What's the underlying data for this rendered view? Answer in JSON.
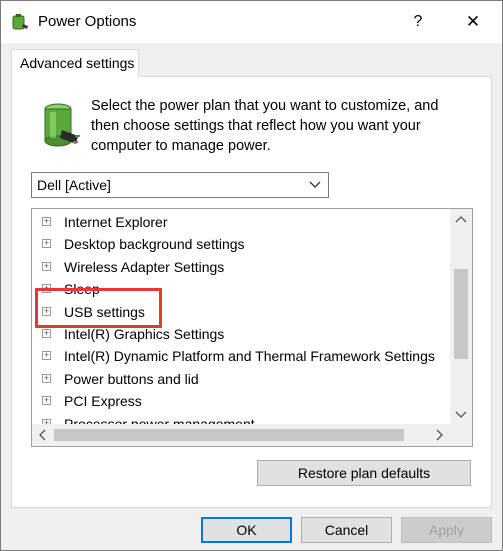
{
  "window": {
    "title": "Power Options",
    "help_glyph": "?",
    "close_glyph": "✕"
  },
  "tab": {
    "label": "Advanced settings"
  },
  "description": "Select the power plan that you want to customize, and then choose settings that reflect how you want your computer to manage power.",
  "plan_select": {
    "value": "Dell [Active]"
  },
  "settings_tree": {
    "items": [
      {
        "label": "Internet Explorer"
      },
      {
        "label": "Desktop background settings"
      },
      {
        "label": "Wireless Adapter Settings"
      },
      {
        "label": "Sleep"
      },
      {
        "label": "USB settings"
      },
      {
        "label": "Intel(R) Graphics Settings"
      },
      {
        "label": "Intel(R) Dynamic Platform and Thermal Framework Settings"
      },
      {
        "label": "Power buttons and lid"
      },
      {
        "label": "PCI Express"
      },
      {
        "label": "Processor power management"
      }
    ],
    "expander_glyph": "+"
  },
  "buttons": {
    "restore": "Restore plan defaults",
    "ok": "OK",
    "cancel": "Cancel",
    "apply": "Apply"
  },
  "icons": {
    "title": "power-options-icon",
    "plan": "battery-plug-icon"
  },
  "colors": {
    "highlight": "#e53935",
    "focus_border": "#0078d7"
  }
}
